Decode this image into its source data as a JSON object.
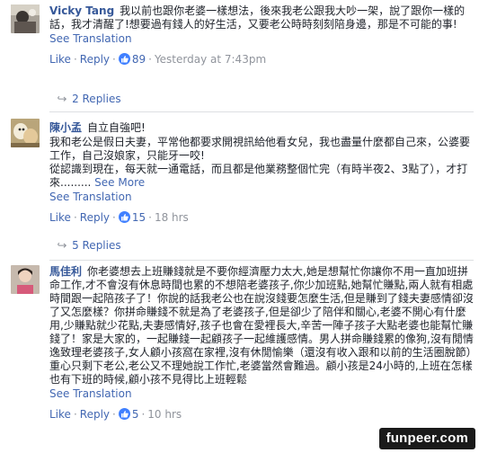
{
  "colors": {
    "link": "#4267b2",
    "author": "#365899",
    "meta": "#90949c",
    "like_badge": "#4080ff"
  },
  "comments": [
    {
      "author": "Vicky Tang",
      "text": "我以前也跟你老婆一樣想法，後來我老公跟我大吵一架，說了跟你一樣的話，我才清醒了!想要過有錢人的好生活，又要老公時時刻刻陪身邊，那是不可能的事!",
      "see_translation": "See Translation",
      "like": "Like",
      "reply": "Reply",
      "likes": "89",
      "time": "Yesterday at 7:43pm",
      "replies": "2 Replies",
      "avatar_icon": "avatar-image"
    },
    {
      "author": "陳小孟",
      "first_line": "自立自強吧!",
      "para1": "我和老公是假日夫妻，平常他都要求開視訊給他看女兒，我也盡量什麼都自己來，公婆要工作，自己沒娘家，只能牙一咬!",
      "para2": "從認識到現在，每天就一通電話，而且都是他業務整個忙完（有時半夜2、3點了），才打來.........",
      "see_more": "See More",
      "see_translation": "See Translation",
      "like": "Like",
      "reply": "Reply",
      "likes": "15",
      "time": "18 hrs",
      "replies": "5 Replies",
      "avatar_icon": "avatar-image"
    },
    {
      "author": "馬佳利",
      "text": "你老婆想去上班賺錢就是不要你經濟壓力太大,她是想幫忙你讓你不用一直加班拼命工作,才不會沒有休息時間也累的不想陪老婆孩子,你少加班點,她幫忙賺點,兩人就有相處時間跟一起陪孩子了！你說的話我老公也在說沒錢要怎麼生活,但是賺到了錢夫妻感情卻沒了又怎麼樣？你拼命賺錢不就是為了老婆孩子,但是卻少了陪伴和關心,老婆不開心有什麼用,少賺點就少花點,夫妻感情好,孩子也會在愛裡長大,辛苦一陣子孩子大點老婆也能幫忙賺錢了！家是大家的，一起賺錢一起顧孩子一起維護感情。男人拼命賺錢累的像狗,沒有閒情逸致理老婆孩子,女人顧小孩窩在家裡,沒有休閒愉樂（還沒有收入跟和以前的生活圈脫節）重心只剩下老公,老公又不理她說工作忙,老婆當然會難過。顧小孩是24小時的,上班在怎樣也有下班的時候,顧小孩不見得比上班輕鬆",
      "see_translation": "See Translation",
      "like": "Like",
      "reply": "Reply",
      "likes": "5",
      "time": "10 hrs",
      "avatar_icon": "avatar-image"
    }
  ],
  "watermark": "funpeer.com"
}
